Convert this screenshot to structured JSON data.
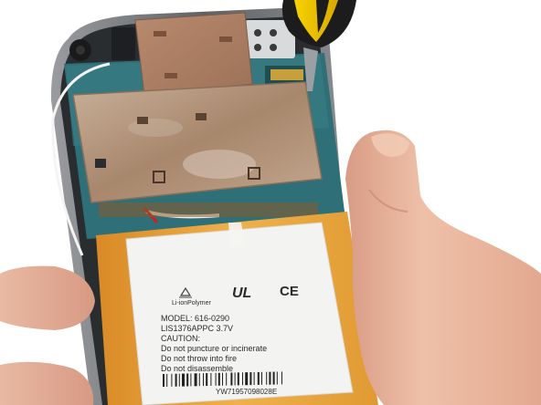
{
  "battery_label": {
    "chemistry": "Li-ionPolymer",
    "model": "MODEL:  616-0290",
    "part": "LIS1376APPC  3.7V",
    "caution_title": "CAUTION:",
    "caution_lines": [
      "Do not puncture or incinerate",
      "Do not throw into fire",
      "Do not disassemble"
    ],
    "serial": "YW71957098028E",
    "marks": {
      "ul": "UL",
      "ce": "CE"
    }
  },
  "colors": {
    "background": "#ffffff",
    "battery_orange": "#e8a23a",
    "label_white": "#f3f3f1",
    "shield_metal": "#b89a7c",
    "pcb_teal": "#2f6f78",
    "skin": "#e8b59d",
    "screwdriver_yellow": "#f2c400",
    "screwdriver_black": "#1c1c1c"
  },
  "icons": [
    "recycle-icon",
    "ul-mark-icon",
    "ce-mark-icon",
    "barcode"
  ]
}
